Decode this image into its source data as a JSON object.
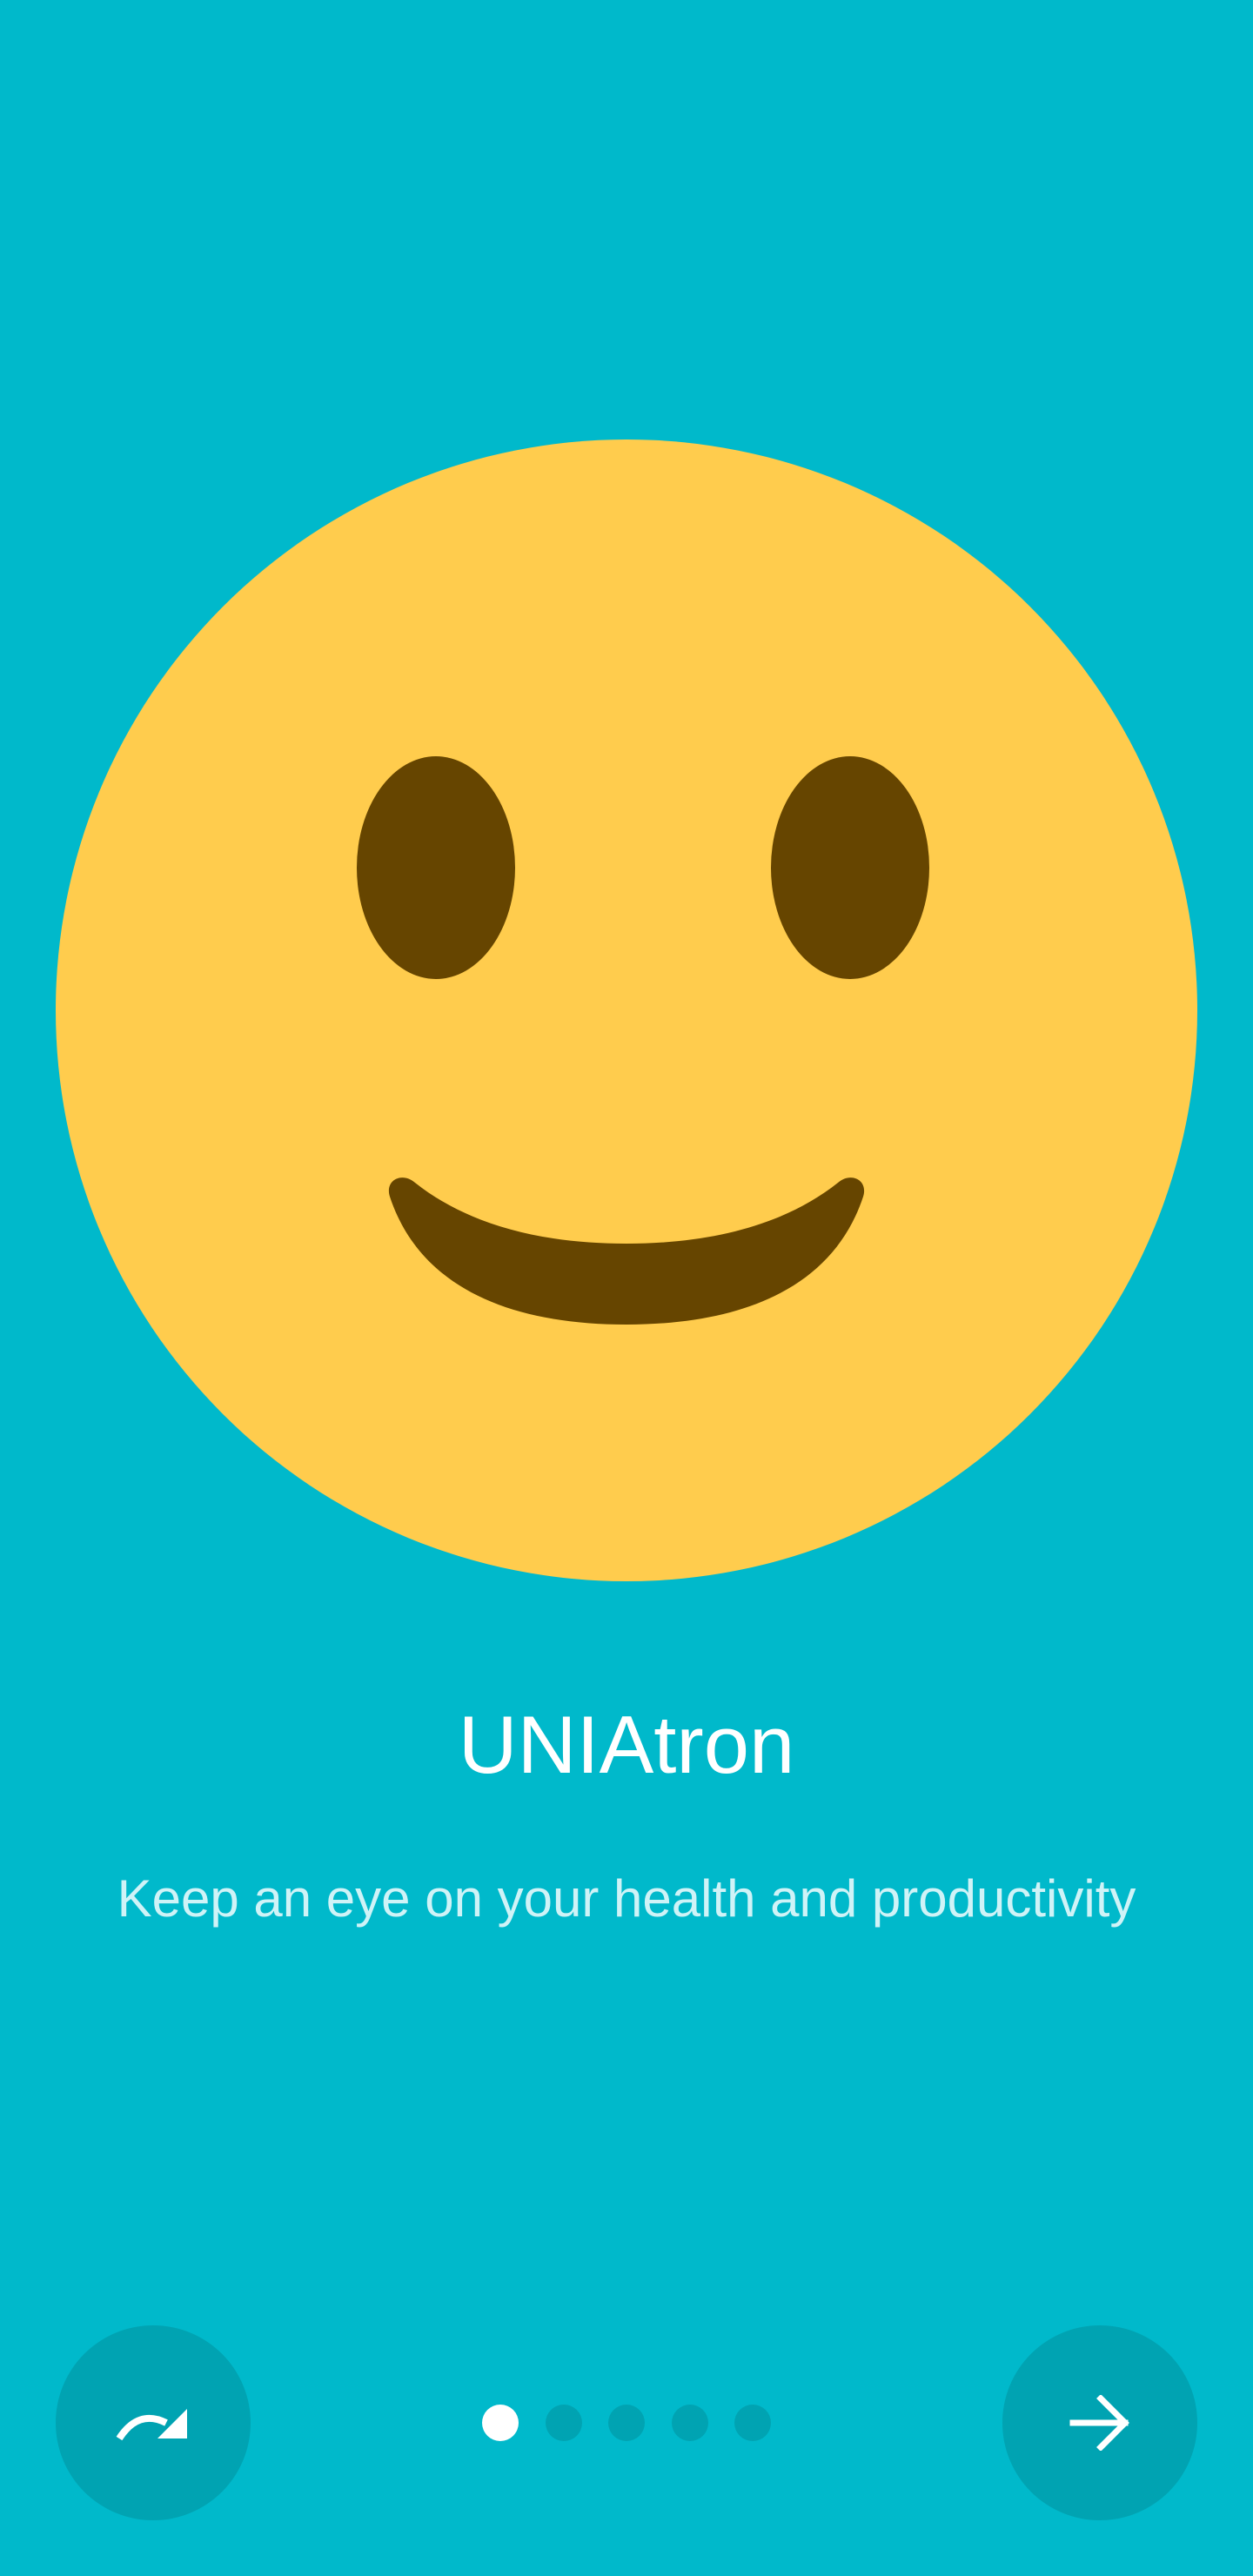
{
  "onboarding": {
    "title": "UNIAtron",
    "subtitle": "Keep an eye on your health and productivity",
    "illustration": "slightly-smiling-face-emoji",
    "page_count": 5,
    "current_page": 1
  },
  "controls": {
    "skip_icon": "redo-arrow-icon",
    "next_icon": "arrow-right-icon"
  },
  "colors": {
    "background": "#00B9CB",
    "button": "#00A3B2",
    "emoji_face": "#FFCC4D",
    "emoji_features": "#664500",
    "active_dot": "#FFFFFF",
    "inactive_dot": "#00A3B2",
    "title": "#FFFFFF",
    "subtitle": "#CFF3F7"
  }
}
